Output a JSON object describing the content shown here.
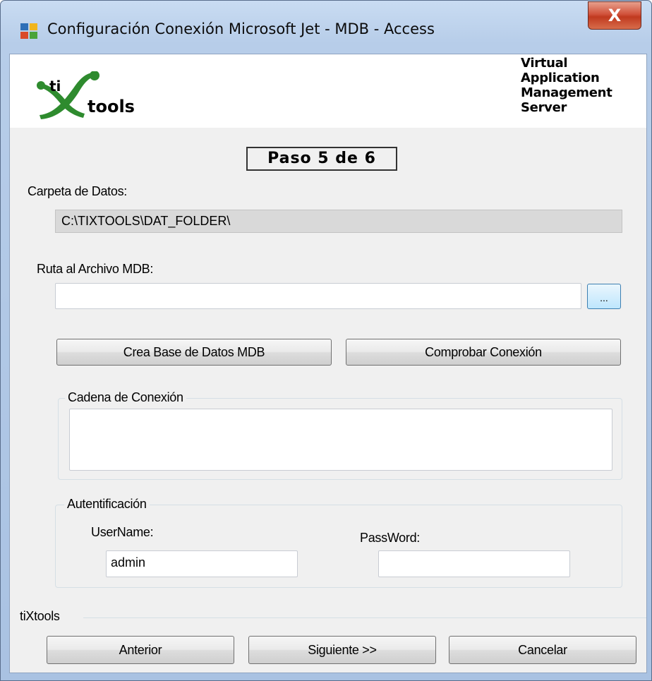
{
  "window": {
    "title": "Configuración Conexión Microsoft Jet - MDB - Access",
    "close_glyph": "X"
  },
  "icons": {
    "app": "app-icon",
    "close": "close-icon",
    "logo": "tixtools-logo"
  },
  "header": {
    "logo_text_ti": "ti",
    "logo_text_tools": "tools",
    "product_lines": [
      "Virtual",
      "Application",
      "Management",
      "Server"
    ]
  },
  "step": {
    "label": "Paso 5 de 6"
  },
  "data_folder": {
    "label": "Carpeta de Datos:",
    "value": "C:\\TIXTOOLS\\DAT_FOLDER\\"
  },
  "mdb_path": {
    "label": "Ruta al Archivo MDB:",
    "value": "",
    "browse_label": "..."
  },
  "actions": {
    "create_db": "Crea Base de Datos MDB",
    "test_connection": "Comprobar Conexión"
  },
  "connection_string": {
    "group_label": "Cadena de Conexión",
    "value": ""
  },
  "auth": {
    "group_label": "Autentificación",
    "username_label": "UserName:",
    "username_value": "admin",
    "password_label": "PassWord:",
    "password_value": ""
  },
  "footer": {
    "brand": "tiXtools",
    "back": "Anterior",
    "next": "Siguiente >>",
    "cancel": "Cancelar"
  },
  "colors": {
    "logo_green": "#2e8b2e",
    "title_bar": "#b9d1ea",
    "close_red": "#c9432a"
  }
}
